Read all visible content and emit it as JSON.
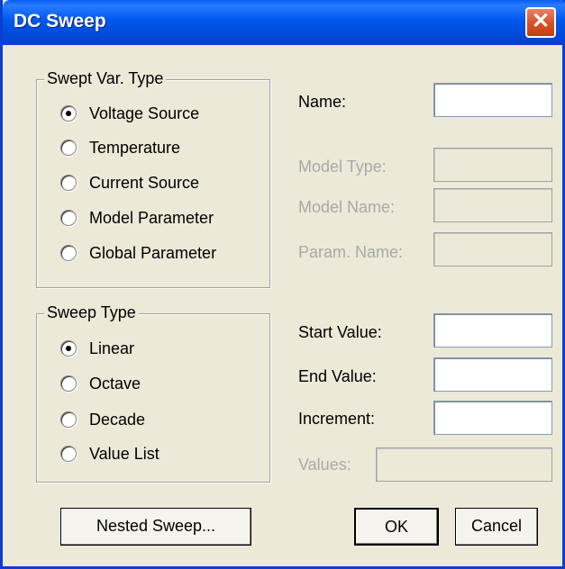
{
  "window": {
    "title": "DC Sweep",
    "close_glyph": "✕"
  },
  "swept_var_type": {
    "title": "Swept Var. Type",
    "options": [
      {
        "label": "Voltage Source",
        "checked": true
      },
      {
        "label": "Temperature",
        "checked": false
      },
      {
        "label": "Current Source",
        "checked": false
      },
      {
        "label": "Model Parameter",
        "checked": false
      },
      {
        "label": "Global Parameter",
        "checked": false
      }
    ]
  },
  "sweep_type": {
    "title": "Sweep Type",
    "options": [
      {
        "label": "Linear",
        "checked": true
      },
      {
        "label": "Octave",
        "checked": false
      },
      {
        "label": "Decade",
        "checked": false
      },
      {
        "label": "Value List",
        "checked": false
      }
    ]
  },
  "fields": {
    "name": {
      "label": "Name:",
      "value": ""
    },
    "model_type": {
      "label": "Model Type:",
      "value": ""
    },
    "model_name": {
      "label": "Model Name:",
      "value": ""
    },
    "param_name": {
      "label": "Param. Name:",
      "value": ""
    },
    "start_value": {
      "label": "Start Value:",
      "value": ""
    },
    "end_value": {
      "label": "End Value:",
      "value": ""
    },
    "increment": {
      "label": "Increment:",
      "value": ""
    },
    "values": {
      "label": "Values:",
      "value": ""
    }
  },
  "buttons": {
    "nested_sweep": "Nested Sweep...",
    "ok": "OK",
    "cancel": "Cancel"
  }
}
